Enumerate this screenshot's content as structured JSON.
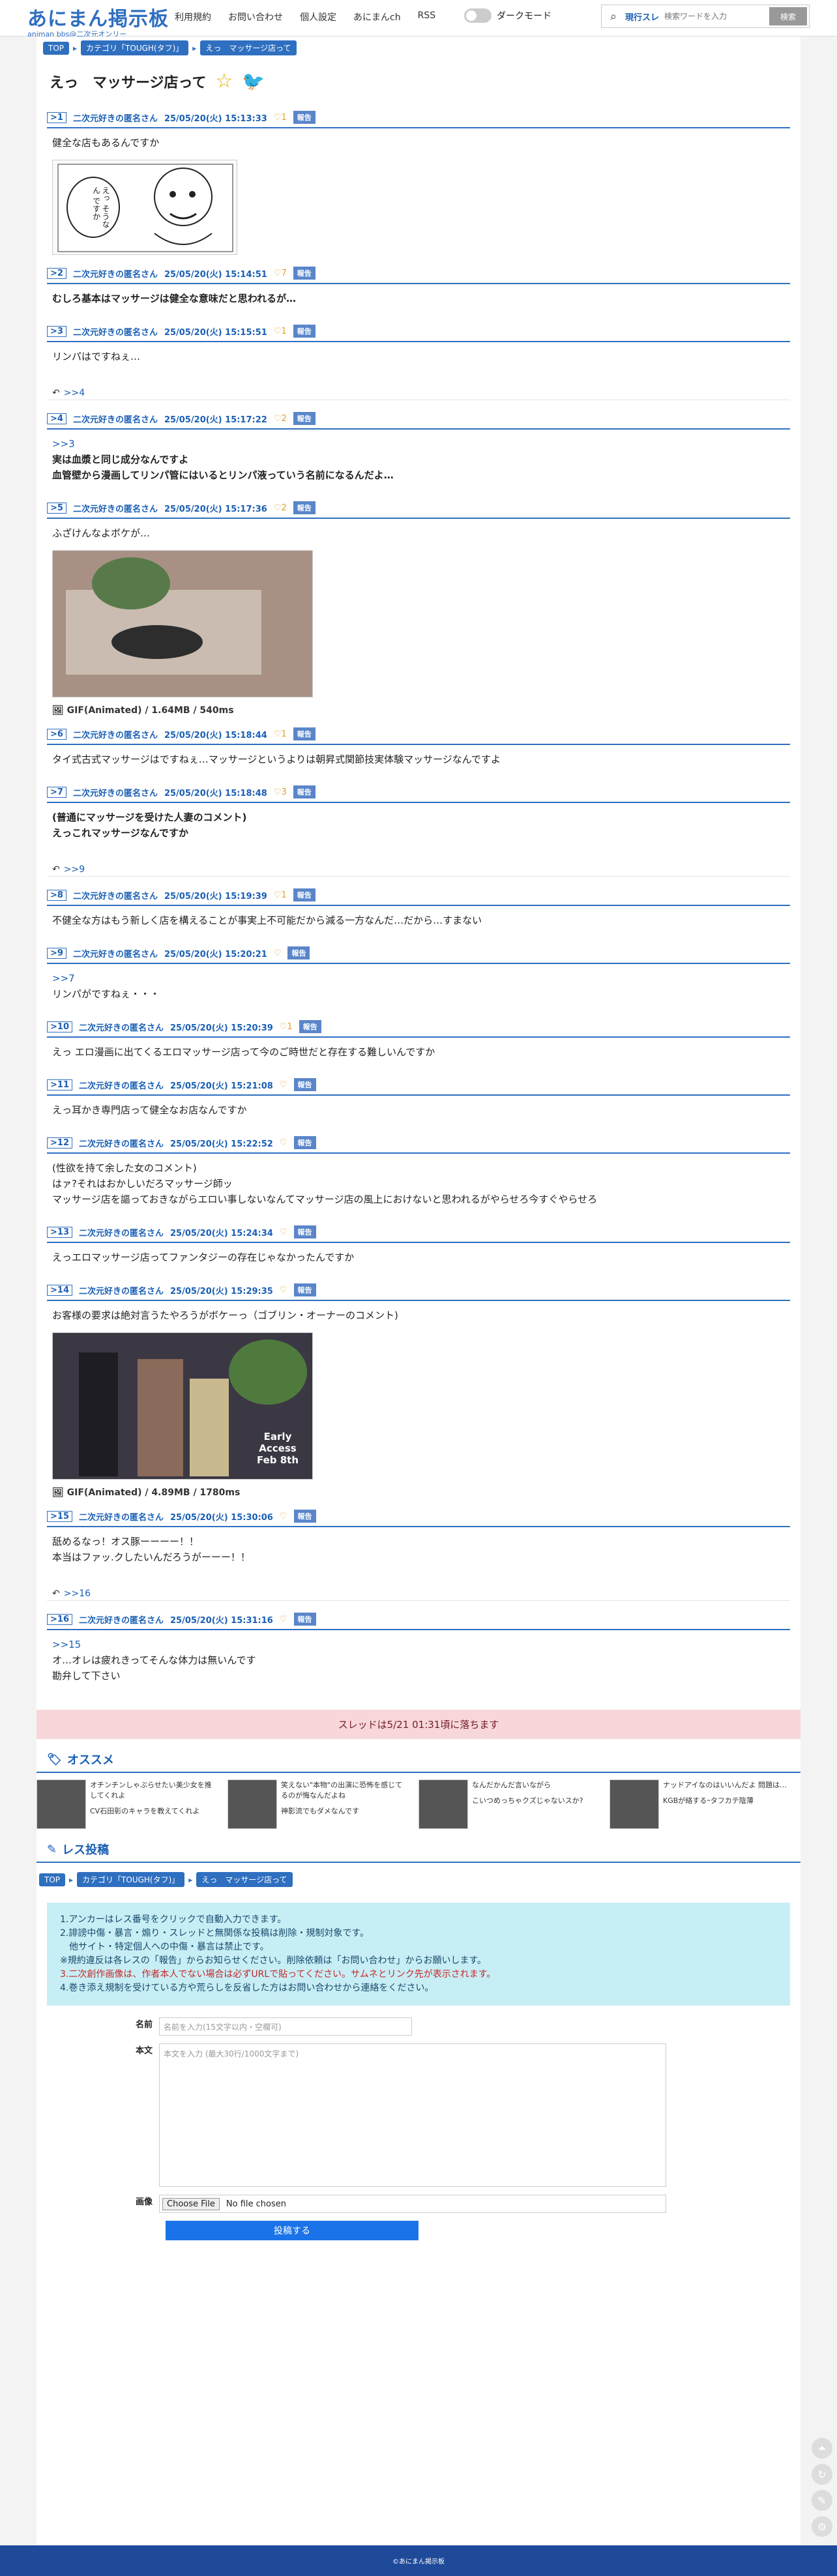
{
  "header": {
    "logo": "あにまん掲示板",
    "logo_sub": "animan bbs@二次元オンリー",
    "nav": [
      "利用規約",
      "お問い合わせ",
      "個人設定",
      "あにまんch",
      "RSS"
    ],
    "dark_mode": "ダークモード",
    "search_mode": "現行スレ",
    "search_placeholder": "検索ワードを入力",
    "search_button": "検索"
  },
  "breadcrumb": [
    "TOP",
    "カテゴリ「TOUGH(タフ)」",
    "えっ　マッサージ店って"
  ],
  "thread_title": "えっ　マッサージ店って",
  "posts": [
    {
      "num": ">1",
      "name": "二次元好きの匿名さん",
      "date": "25/05/20(火) 15:13:33",
      "likes": "1",
      "report": "報告",
      "lines": [
        "健全な店もあるんですか"
      ]
    },
    {
      "num": ">2",
      "name": "二次元好きの匿名さん",
      "date": "25/05/20(火) 15:14:51",
      "likes": "7",
      "report": "報告",
      "lines": [
        "むしろ基本はマッサージは健全な意味だと思われるが…"
      ]
    },
    {
      "num": ">3",
      "name": "二次元好きの匿名さん",
      "date": "25/05/20(火) 15:15:51",
      "likes": "1",
      "report": "報告",
      "lines": [
        "リンパはですねぇ…"
      ],
      "reply": ">>4"
    },
    {
      "num": ">4",
      "name": "二次元好きの匿名さん",
      "date": "25/05/20(火) 15:17:22",
      "likes": "2",
      "report": "報告",
      "anchor": ">>3",
      "lines": [
        "実は血漿と同じ成分なんですよ",
        "血管壁から漫画してリンパ管にはいるとリンパ液っていう名前になるんだよ…"
      ]
    },
    {
      "num": ">5",
      "name": "二次元好きの匿名さん",
      "date": "25/05/20(火) 15:17:36",
      "likes": "2",
      "report": "報告",
      "lines": [
        "ふざけんなよボケが…"
      ],
      "file": "GIF(Animated) / 1.64MB / 540ms"
    },
    {
      "num": ">6",
      "name": "二次元好きの匿名さん",
      "date": "25/05/20(火) 15:18:44",
      "likes": "1",
      "report": "報告",
      "lines": [
        "タイ式古式マッサージはですねぇ…マッサージというよりは朝昇式関節技実体験マッサージなんですよ"
      ]
    },
    {
      "num": ">7",
      "name": "二次元好きの匿名さん",
      "date": "25/05/20(火) 15:18:48",
      "likes": "3",
      "report": "報告",
      "lines": [
        "(普通にマッサージを受けた人妻のコメント)",
        "えっこれマッサージなんですか"
      ],
      "reply": ">>9"
    },
    {
      "num": ">8",
      "name": "二次元好きの匿名さん",
      "date": "25/05/20(火) 15:19:39",
      "likes": "1",
      "report": "報告",
      "lines": [
        "不健全な方はもう新しく店を構えることが事実上不可能だから減る一方なんだ…だから…すまない"
      ]
    },
    {
      "num": ">9",
      "name": "二次元好きの匿名さん",
      "date": "25/05/20(火) 15:20:21",
      "likes": "",
      "report": "報告",
      "anchor": ">>7",
      "lines": [
        "リンパがですねぇ・・・"
      ]
    },
    {
      "num": ">10",
      "name": "二次元好きの匿名さん",
      "date": "25/05/20(火) 15:20:39",
      "likes": "1",
      "report": "報告",
      "lines": [
        "えっ エロ漫画に出てくるエロマッサージ店って今のご時世だと存在する難しいんですか"
      ]
    },
    {
      "num": ">11",
      "name": "二次元好きの匿名さん",
      "date": "25/05/20(火) 15:21:08",
      "likes": "",
      "report": "報告",
      "lines": [
        "えっ耳かき専門店って健全なお店なんですか"
      ]
    },
    {
      "num": ">12",
      "name": "二次元好きの匿名さん",
      "date": "25/05/20(火) 15:22:52",
      "likes": "",
      "report": "報告",
      "lines": [
        "(性欲を持て余した女のコメント)",
        "はァ?それはおかしいだろマッサージ師ッ",
        "マッサージ店を謳っておきながらエロい事しないなんてマッサージ店の風上におけないと思われるがやらせろ今すぐやらせろ"
      ]
    },
    {
      "num": ">13",
      "name": "二次元好きの匿名さん",
      "date": "25/05/20(火) 15:24:34",
      "likes": "",
      "report": "報告",
      "lines": [
        "えっエロマッサージ店ってファンタジーの存在じゃなかったんですか"
      ]
    },
    {
      "num": ">14",
      "name": "二次元好きの匿名さん",
      "date": "25/05/20(火) 15:29:35",
      "likes": "",
      "report": "報告",
      "lines": [
        "お客様の要求は絶対言うたやろうがボケーっ（ゴブリン・オーナーのコメント)"
      ],
      "file": "GIF(Animated) / 4.89MB / 1780ms"
    },
    {
      "num": ">15",
      "name": "二次元好きの匿名さん",
      "date": "25/05/20(火) 15:30:06",
      "likes": "",
      "report": "報告",
      "lines": [
        "舐めるなっ！オス豚ーーーー！！",
        "本当はファッ.クしたいんだろうがーーー！！"
      ],
      "reply": ">>16"
    },
    {
      "num": ">16",
      "name": "二次元好きの匿名さん",
      "date": "25/05/20(火) 15:31:16",
      "likes": "",
      "report": "報告",
      "anchor": ">>15",
      "lines": [
        "オ…オレは疲れきってそんな体力は無いんです",
        "勘弁して下さい"
      ]
    }
  ],
  "manga_text": "えっ そうなん ですか",
  "gif2_text": "Early Access Feb 8th",
  "expire": "スレッドは5/21 01:31頃に落ちます",
  "recommend": {
    "title": "オススメ",
    "items": [
      {
        "lines": [
          "オチンチンしゃぶらせたい美少女を推",
          "してくれよ",
          "CV石田彰のキャラを教えてくれよ"
        ]
      },
      {
        "lines": [
          "笑えない\"本物\"の出演に恐怖を感じて",
          "るのが悔なんだよね",
          "神影流でもダメなんです"
        ]
      },
      {
        "lines": [
          "なんだかんだ言いながら",
          "こいつめっちゃクズじゃないスか?"
        ]
      },
      {
        "lines": [
          "ナッドアイなのはいいんだよ 問題は…",
          "KGBが絡するｰタフカテ陰薄"
        ]
      }
    ]
  },
  "form": {
    "title": "レス投稿",
    "rules": [
      "1.アンカーはレス番号をクリックで自動入力できます。",
      "2.誹謗中傷・暴言・煽り・スレッドと無関係な投稿は削除・規制対象です。",
      "　他サイト・特定個人への中傷・暴言は禁止です。",
      "※規約違反は各レスの「報告」からお知らせください。削除依頼は「お問い合わせ」からお願いします。",
      "3.二次創作画像は、作者本人でない場合は必ずURLで貼ってください。サムネとリンク先が表示されます。",
      "4.巻き添え規制を受けている方や荒らしを反省した方はお問い合わせから連絡をください。"
    ],
    "name_label": "名前",
    "name_placeholder": "名前を入力(15文字以内・空欄可)",
    "body_label": "本文",
    "body_placeholder": "本文を入力 (最大30行/1000文字まで)",
    "image_label": "画像",
    "file_button": "Choose File",
    "file_status": "No file chosen",
    "submit": "投稿する"
  },
  "footer": "©あにまん掲示板"
}
